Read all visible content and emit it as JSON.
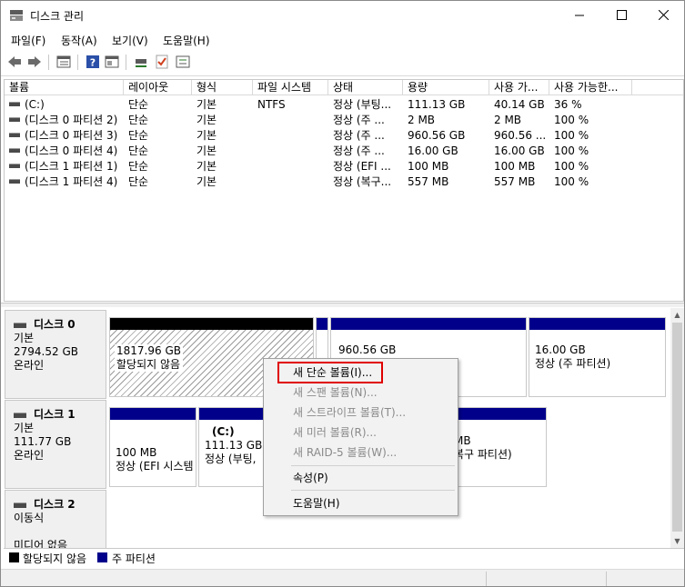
{
  "window": {
    "title": "디스크 관리"
  },
  "menu": [
    "파일(F)",
    "동작(A)",
    "보기(V)",
    "도움말(H)"
  ],
  "toolbar": {
    "icons": [
      "back-icon",
      "forward-icon",
      "show-list-icon",
      "help-icon",
      "properties-icon",
      "connect-icon",
      "check-icon",
      "settings-icon"
    ]
  },
  "volume_list": {
    "columns": [
      "볼륨",
      "레이아웃",
      "형식",
      "파일 시스템",
      "상태",
      "용량",
      "사용 가...",
      "사용 가능한..."
    ],
    "rows": [
      {
        "volume": "(C:)",
        "layout": "단순",
        "type": "기본",
        "fs": "NTFS",
        "status": "정상 (부팅...",
        "capacity": "111.13 GB",
        "free": "40.14 GB",
        "free_pct": "36 %"
      },
      {
        "volume": "(디스크 0 파티션 2)",
        "layout": "단순",
        "type": "기본",
        "fs": "",
        "status": "정상 (주 ...",
        "capacity": "2 MB",
        "free": "2 MB",
        "free_pct": "100 %"
      },
      {
        "volume": "(디스크 0 파티션 3)",
        "layout": "단순",
        "type": "기본",
        "fs": "",
        "status": "정상 (주 ...",
        "capacity": "960.56 GB",
        "free": "960.56 ...",
        "free_pct": "100 %"
      },
      {
        "volume": "(디스크 0 파티션 4)",
        "layout": "단순",
        "type": "기본",
        "fs": "",
        "status": "정상 (주 ...",
        "capacity": "16.00 GB",
        "free": "16.00 GB",
        "free_pct": "100 %"
      },
      {
        "volume": "(디스크 1 파티션 1)",
        "layout": "단순",
        "type": "기본",
        "fs": "",
        "status": "정상 (EFI ...",
        "capacity": "100 MB",
        "free": "100 MB",
        "free_pct": "100 %"
      },
      {
        "volume": "(디스크 1 파티션 4)",
        "layout": "단순",
        "type": "기본",
        "fs": "",
        "status": "정상 (복구...",
        "capacity": "557 MB",
        "free": "557 MB",
        "free_pct": "100 %"
      }
    ]
  },
  "disks": [
    {
      "name": "디스크 0",
      "kind": "기본",
      "size": "2794.52 GB",
      "state": "온라인",
      "partitions": [
        {
          "label": "",
          "line1": "1817.96 GB",
          "line2": "할당되지 않음",
          "style": "unallocated"
        },
        {
          "label": "",
          "line1": "",
          "line2": "",
          "style": "primary"
        },
        {
          "label": "",
          "line1": "960.56 GB",
          "line2": "",
          "style": "primary"
        },
        {
          "label": "",
          "line1": "16.00 GB",
          "line2": "정상 (주 파티션)",
          "style": "primary"
        }
      ]
    },
    {
      "name": "디스크 1",
      "kind": "기본",
      "size": "111.77 GB",
      "state": "온라인",
      "partitions": [
        {
          "label": "",
          "line1": "100 MB",
          "line2": "정상 (EFI 시스템",
          "style": "primary"
        },
        {
          "label": "(C:)",
          "line1": "111.13 GB",
          "line2": "정상 (부팅,",
          "style": "primary"
        },
        {
          "label": "",
          "line1": "MB",
          "line2": "복구 파티션)",
          "style": "primary"
        }
      ]
    },
    {
      "name": "디스크 2",
      "kind": "이동식",
      "size": "",
      "state": "미디어 없음",
      "partitions": []
    }
  ],
  "legend": [
    {
      "label": "할당되지 않음",
      "color": "#000000"
    },
    {
      "label": "주 파티션",
      "color": "#00008b"
    }
  ],
  "context_menu": {
    "items": [
      {
        "label": "새 단순 볼륨(I)...",
        "enabled": true,
        "highlighted": true
      },
      {
        "label": "새 스팬 볼륨(N)...",
        "enabled": false
      },
      {
        "label": "새 스트라이프 볼륨(T)...",
        "enabled": false
      },
      {
        "label": "새 미러 볼륨(R)...",
        "enabled": false
      },
      {
        "label": "새 RAID-5 볼륨(W)...",
        "enabled": false
      },
      {
        "label": "속성(P)",
        "enabled": true
      },
      {
        "label": "도움말(H)",
        "enabled": true
      }
    ]
  }
}
